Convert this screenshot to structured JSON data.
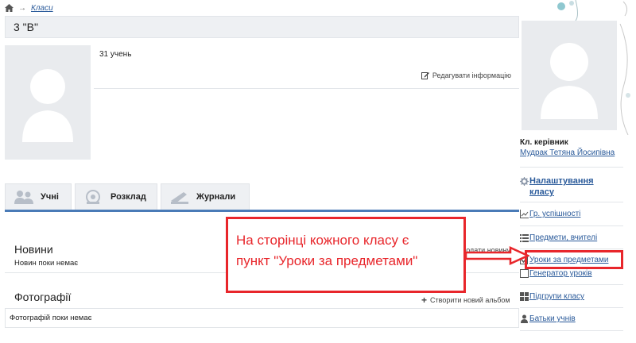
{
  "breadcrumb": {
    "link": "Класи"
  },
  "header": {
    "title": "3 \"В\""
  },
  "info": {
    "student_count": "31 учень",
    "edit_label": "Редагувати інформацію"
  },
  "tabs": [
    {
      "label": "Учні",
      "icon": "students-icon"
    },
    {
      "label": "Розклад",
      "icon": "schedule-icon"
    },
    {
      "label": "Журнали",
      "icon": "journals-icon"
    }
  ],
  "news": {
    "title": "Новини",
    "empty": "Новин поки немає",
    "add_label": "Додати новину"
  },
  "photos": {
    "title": "Фотографії",
    "empty": "Фотографій поки немає",
    "create_album": "Створити новий альбом"
  },
  "callout": {
    "line1": "На сторінці кожного класу є",
    "line2": "пункт \"Уроки за предметами\"",
    "color": "#e8262b"
  },
  "sidebar": {
    "teacher_label": "Кл. керівник",
    "teacher_name": "Мудрак Тетяна Йосипівна",
    "settings_label": "Налаштування класу",
    "items": [
      {
        "label": "Гр. успішності",
        "icon": "chart-icon"
      },
      {
        "label": "Предмети, вчителі",
        "icon": "list-icon"
      },
      {
        "label": "Уроки за предметами",
        "icon": "checkbox-icon"
      },
      {
        "label": "Генератор уроків",
        "icon": "generator-icon"
      },
      {
        "label": "Підгрупи класу",
        "icon": "groups-icon"
      },
      {
        "label": "Батьки учнів",
        "icon": "parents-icon"
      }
    ]
  },
  "colors": {
    "accent": "#4a7bb7",
    "link": "#2a5a9a",
    "highlight": "#e8262b"
  }
}
